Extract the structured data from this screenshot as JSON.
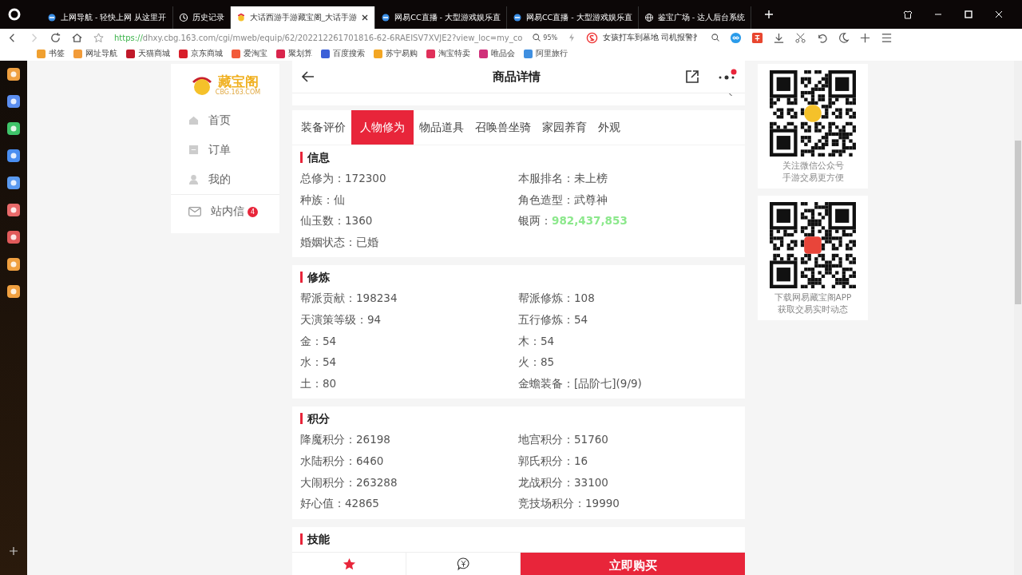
{
  "browser": {
    "tabs": [
      {
        "title": "上网导航 - 轻快上网 从这里开",
        "selected": false,
        "kind": "ie"
      },
      {
        "title": "历史记录",
        "selected": false,
        "kind": "history"
      },
      {
        "title": "大话西游手游藏宝阁_大话手游",
        "selected": true,
        "kind": "cbg"
      },
      {
        "title": "网易CC直播 - 大型游戏娱乐直",
        "selected": false,
        "kind": "ie"
      },
      {
        "title": "网易CC直播 - 大型游戏娱乐直",
        "selected": false,
        "kind": "ie"
      },
      {
        "title": "鉴宝广场 - 达人后台系统",
        "selected": false,
        "kind": "globe"
      }
    ],
    "address": {
      "scheme": "https://",
      "rest": "dhxy.cbg.163.com/cgi/mweb/equip/62/202212261701816-62-6RAEISV7XVJE2?view_loc=my_co",
      "zoom": "95%",
      "search": "女孩打车到墓地 司机报警扌"
    },
    "bookmarks": [
      {
        "label": "书签",
        "color": "#f0a030"
      },
      {
        "label": "网址导航",
        "color": "#f29b38"
      },
      {
        "label": "天猫商城",
        "color": "#c0192a"
      },
      {
        "label": "京东商城",
        "color": "#d81e2a"
      },
      {
        "label": "爱淘宝",
        "color": "#f25a3a"
      },
      {
        "label": "聚划算",
        "color": "#d9254c"
      },
      {
        "label": "百度搜索",
        "color": "#3b5fd8"
      },
      {
        "label": "苏宁易购",
        "color": "#f3a623"
      },
      {
        "label": "淘宝特卖",
        "color": "#e0305a"
      },
      {
        "label": "唯品会",
        "color": "#d0307a"
      },
      {
        "label": "阿里旅行",
        "color": "#3f8fe0"
      }
    ]
  },
  "dock": [
    {
      "color": "#f0a040"
    },
    {
      "color": "#5b8ef0"
    },
    {
      "color": "#3fc46a"
    },
    {
      "color": "#4a8ef0"
    },
    {
      "color": "#5a9af0"
    },
    {
      "color": "#e86a6a"
    },
    {
      "color": "#e05a5a"
    },
    {
      "color": "#f0a040"
    },
    {
      "color": "#f0a040"
    }
  ],
  "nav": {
    "logo": "藏宝阁",
    "logo_sub": "CBG.163.COM",
    "items": [
      {
        "label": "首页",
        "kind": "home"
      },
      {
        "label": "订单",
        "kind": "order"
      },
      {
        "label": "我的",
        "kind": "user"
      }
    ],
    "messages": {
      "label": "站内信",
      "badge": "4"
    }
  },
  "header": {
    "title": "商品详情",
    "has_notice": true
  },
  "tabs": [
    {
      "label": "装备评价",
      "selected": false
    },
    {
      "label": "人物修为",
      "selected": true
    },
    {
      "label": "物品道具",
      "selected": false
    },
    {
      "label": "召唤兽坐骑",
      "selected": false
    },
    {
      "label": "家园养育",
      "selected": false
    },
    {
      "label": "外观",
      "selected": false
    }
  ],
  "sections": [
    {
      "title": "信息",
      "items": [
        {
          "label": "总修为：",
          "value": "172300",
          "kind": "text"
        },
        {
          "label": "本服排名：",
          "value": "未上榜",
          "kind": "text"
        },
        {
          "label": "种族：",
          "value": "仙",
          "kind": "text"
        },
        {
          "label": "角色造型：",
          "value": "武尊神",
          "kind": "text"
        },
        {
          "label": "仙玉数：",
          "value": "1360",
          "kind": "text"
        },
        {
          "label": "银两：",
          "value": "982,437,853",
          "kind": "money"
        },
        {
          "label": "婚姻状态：",
          "value": "已婚",
          "kind": "text"
        }
      ]
    },
    {
      "title": "修炼",
      "items": [
        {
          "label": "帮派贡献：",
          "value": "198234",
          "kind": "text"
        },
        {
          "label": "帮派修炼：",
          "value": "108",
          "kind": "text"
        },
        {
          "label": "天演策等级：",
          "value": "94",
          "kind": "text"
        },
        {
          "label": "五行修炼：",
          "value": "54",
          "kind": "text"
        },
        {
          "label": "金：",
          "value": "54",
          "kind": "text"
        },
        {
          "label": "木：",
          "value": "54",
          "kind": "text"
        },
        {
          "label": "水：",
          "value": "54",
          "kind": "text"
        },
        {
          "label": "火：",
          "value": "85",
          "kind": "text"
        },
        {
          "label": "土：",
          "value": "80",
          "kind": "text"
        },
        {
          "label": "金蟾装备：",
          "value": "[品阶七](9/9)",
          "kind": "text"
        }
      ]
    },
    {
      "title": "积分",
      "items": [
        {
          "label": "降魔积分：",
          "value": "26198",
          "kind": "text"
        },
        {
          "label": "地宫积分：",
          "value": "51760",
          "kind": "text"
        },
        {
          "label": "水陆积分：",
          "value": "6460",
          "kind": "text"
        },
        {
          "label": "郭氏积分：",
          "value": "16",
          "kind": "text"
        },
        {
          "label": "大闹积分：",
          "value": "263288",
          "kind": "text"
        },
        {
          "label": "龙战积分：",
          "value": "33100",
          "kind": "text"
        },
        {
          "label": "好心值：",
          "value": "42865",
          "kind": "text"
        },
        {
          "label": "竞技场积分：",
          "value": "19990",
          "kind": "text"
        }
      ]
    },
    {
      "title": "技能"
    }
  ],
  "buy_button": "立即购买",
  "qr_cards": [
    {
      "kind": "bell",
      "lines": [
        "关注微信公众号",
        "手游交易更方便"
      ]
    },
    {
      "kind": "app",
      "lines": [
        "下载网易藏宝阁APP",
        "获取交易实时动态"
      ]
    }
  ]
}
